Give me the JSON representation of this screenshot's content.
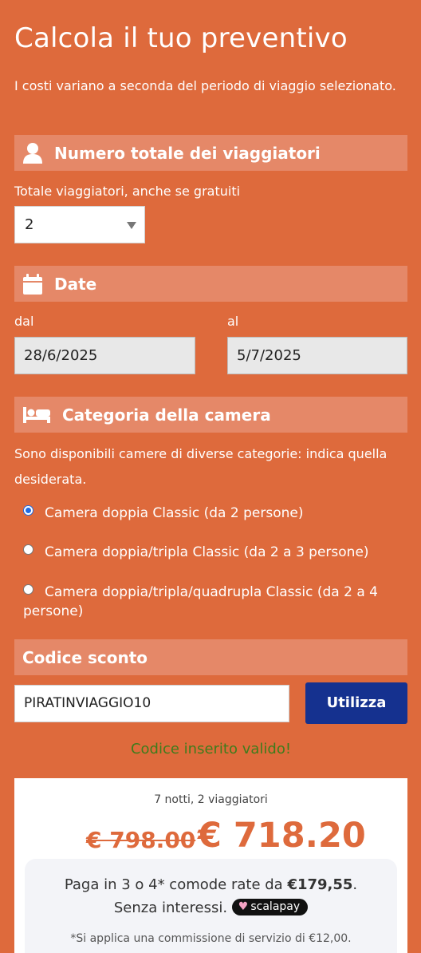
{
  "page": {
    "title": "Calcola il tuo preventivo",
    "intro": "I costi variano a seconda del periodo di viaggio selezionato."
  },
  "travelers": {
    "heading": "Numero totale dei viaggiatori",
    "icon": "user-icon",
    "label": "Totale viaggiatori, anche se gratuiti",
    "selected": "2"
  },
  "dates": {
    "heading": "Date",
    "icon": "calendar-icon",
    "from_label": "dal",
    "from_value": "28/6/2025",
    "to_label": "al",
    "to_value": "5/7/2025"
  },
  "room": {
    "heading": "Categoria della camera",
    "icon": "bed-icon",
    "description": "Sono disponibili camere di diverse categorie: indica quella desiderata.",
    "options": [
      {
        "label": "Camera doppia Classic (da 2 persone)",
        "checked": true
      },
      {
        "label": "Camera doppia/tripla Classic (da 2 a 3 persone)",
        "checked": false
      },
      {
        "label": "Camera doppia/tripla/quadrupla Classic (da 2 a 4 persone)",
        "checked": false
      }
    ]
  },
  "discount": {
    "heading": "Codice sconto",
    "code": "PIRATINVIAGGIO10",
    "button": "Utilizza",
    "status": "Codice inserito valido!",
    "status_color": "#3e7c1c"
  },
  "summary": {
    "nights": "7 notti, 2 viaggiatori",
    "old_price": "€ 798.00",
    "new_price": "€ 718.20",
    "installments_prefix": "Paga in 3 o 4* comode rate da ",
    "installments_amount": "€179,55",
    "installments_suffix": ".",
    "no_interest": "Senza interessi.",
    "scalapay": "scalapay",
    "note": "*Si applica una commissione di servizio di €12,00."
  },
  "colors": {
    "background": "#de6a3c",
    "section_bar": "#e58868",
    "button": "#15318f",
    "price": "#de6a3c"
  }
}
